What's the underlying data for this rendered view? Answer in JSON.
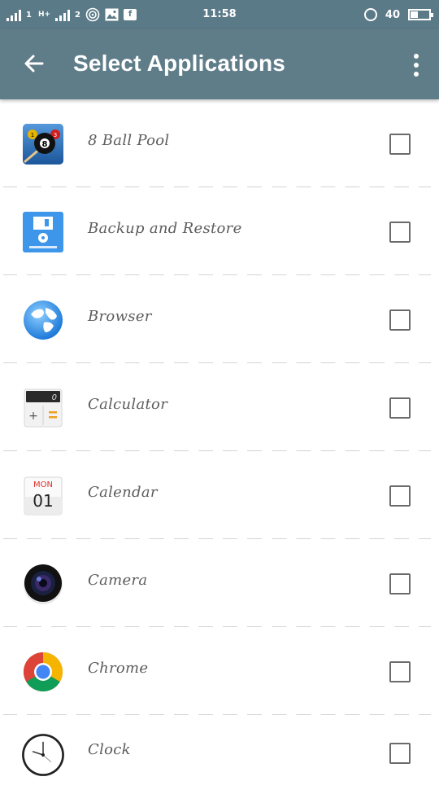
{
  "status_bar": {
    "sim1": "1",
    "network": "H+",
    "sim2": "2",
    "time": "11:58",
    "battery_text": "40"
  },
  "app_bar": {
    "title": "Select Applications",
    "back_icon": "arrow-back-icon",
    "menu_icon": "more-vert-icon"
  },
  "apps": [
    {
      "name": "8 Ball Pool",
      "icon": "8-ball-pool-icon",
      "checked": false
    },
    {
      "name": "Backup and Restore",
      "icon": "backup-restore-icon",
      "checked": false
    },
    {
      "name": "Browser",
      "icon": "browser-globe-icon",
      "checked": false
    },
    {
      "name": "Calculator",
      "icon": "calculator-icon",
      "checked": false,
      "display": "0"
    },
    {
      "name": "Calendar",
      "icon": "calendar-icon",
      "checked": false,
      "month": "MON",
      "day": "01"
    },
    {
      "name": "Camera",
      "icon": "camera-icon",
      "checked": false
    },
    {
      "name": "Chrome",
      "icon": "chrome-icon",
      "checked": false
    },
    {
      "name": "Clock",
      "icon": "clock-icon",
      "checked": false
    }
  ],
  "colors": {
    "status_bar": "#5b7a87",
    "app_bar": "#5f7d89",
    "text": "#5c5c5c"
  }
}
